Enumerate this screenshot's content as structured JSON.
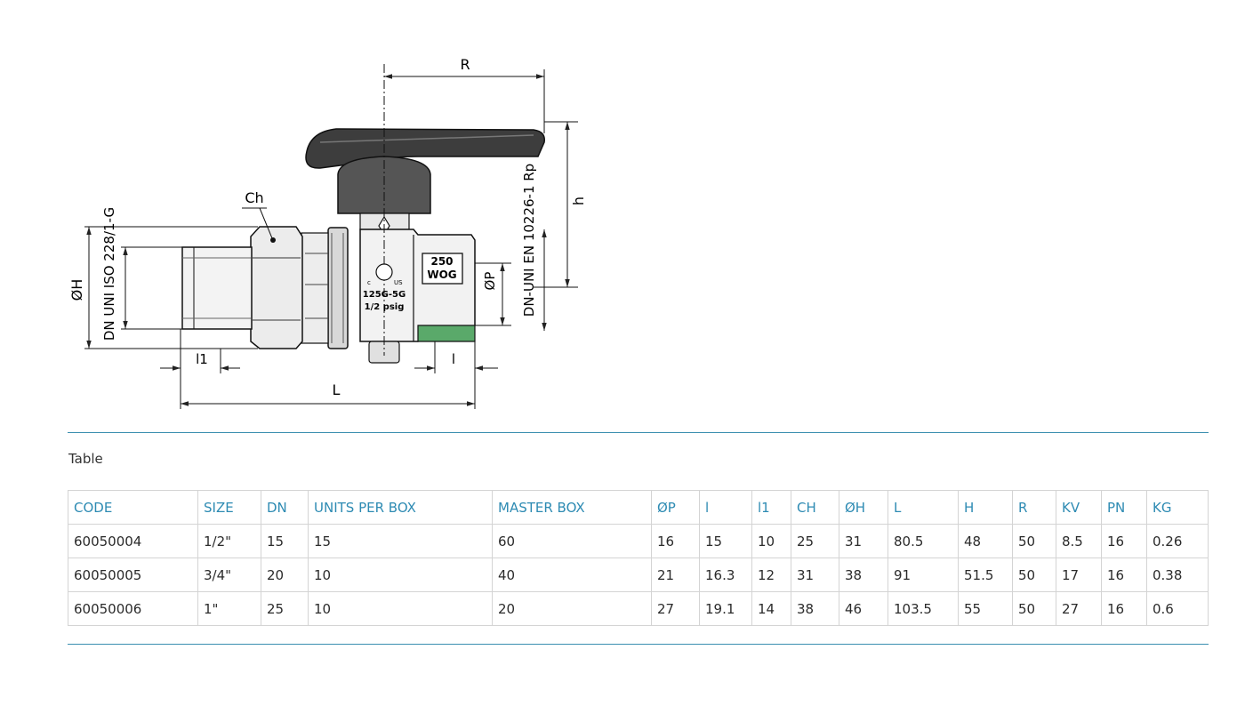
{
  "drawing": {
    "labels": {
      "r": "R",
      "h": "h",
      "ch": "Ch",
      "oh": "ØH",
      "op": "ØP",
      "l": "L",
      "l1": "l1",
      "l_small": "l",
      "thread_left": "DN UNI ISO 228/1-G",
      "thread_right": "DN-UNI EN 10226-1 Rp",
      "pressure_top": "250",
      "pressure_bottom": "WOG",
      "gas_rating": "125G-5G",
      "gas_pressure": "1/2 psig",
      "cert_c": "c",
      "cert_us": "US"
    }
  },
  "table": {
    "caption": "Table",
    "columns": [
      "CODE",
      "SIZE",
      "DN",
      "UNITS PER BOX",
      "MASTER BOX",
      "ØP",
      "l",
      "l1",
      "CH",
      "ØH",
      "L",
      "H",
      "R",
      "KV",
      "PN",
      "KG"
    ],
    "rows": [
      [
        "60050004",
        "1/2\"",
        "15",
        "15",
        "60",
        "16",
        "15",
        "10",
        "25",
        "31",
        "80.5",
        "48",
        "50",
        "8.5",
        "16",
        "0.26"
      ],
      [
        "60050005",
        "3/4\"",
        "20",
        "10",
        "40",
        "21",
        "16.3",
        "12",
        "31",
        "38",
        "91",
        "51.5",
        "50",
        "17",
        "16",
        "0.38"
      ],
      [
        "60050006",
        "1\"",
        "25",
        "10",
        "20",
        "27",
        "19.1",
        "14",
        "38",
        "46",
        "103.5",
        "55",
        "50",
        "27",
        "16",
        "0.6"
      ]
    ]
  },
  "colors": {
    "accent": "#2e8bb3",
    "rule": "#3b8fb0",
    "valve_green": "#5aa96a"
  }
}
